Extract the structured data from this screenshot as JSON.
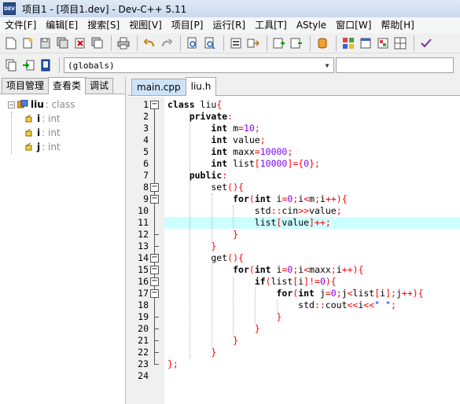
{
  "window": {
    "title": "项目1 - [项目1.dev] - Dev-C++ 5.11",
    "app_icon_text": "DEV"
  },
  "menu": [
    "文件[F]",
    "编辑[E]",
    "搜索[S]",
    "视图[V]",
    "项目[P]",
    "运行[R]",
    "工具[T]",
    "AStyle",
    "窗口[W]",
    "帮助[H]"
  ],
  "toolbar": {
    "globals_combo": "(globals)"
  },
  "left_panel": {
    "tabs": [
      "项目管理",
      "查看类",
      "调试"
    ],
    "active_tab": 1,
    "tree": {
      "class_name": "liu",
      "class_kind": ": class",
      "members": [
        {
          "name": "i",
          "type": ": int"
        },
        {
          "name": "i",
          "type": ": int"
        },
        {
          "name": "j",
          "type": ": int"
        }
      ]
    }
  },
  "editor": {
    "tabs": [
      "main.cpp",
      "liu.h"
    ],
    "active_tab": 1,
    "highlight_line": 11,
    "lines": [
      {
        "n": "1",
        "tokens": [
          [
            "kw",
            "class"
          ],
          [
            "id",
            " liu"
          ],
          [
            "sym",
            "{"
          ]
        ]
      },
      {
        "n": "2",
        "tokens": [
          [
            "id",
            "    "
          ],
          [
            "kw",
            "private"
          ],
          [
            "sym",
            ":"
          ]
        ]
      },
      {
        "n": "3",
        "tokens": [
          [
            "id",
            "        "
          ],
          [
            "kw",
            "int"
          ],
          [
            "id",
            " m"
          ],
          [
            "sym",
            "="
          ],
          [
            "num",
            "10"
          ],
          [
            "sym",
            ";"
          ]
        ]
      },
      {
        "n": "4",
        "tokens": [
          [
            "id",
            "        "
          ],
          [
            "kw",
            "int"
          ],
          [
            "id",
            " value"
          ],
          [
            "sym",
            ";"
          ]
        ]
      },
      {
        "n": "5",
        "tokens": [
          [
            "id",
            "        "
          ],
          [
            "kw",
            "int"
          ],
          [
            "id",
            " maxx"
          ],
          [
            "sym",
            "="
          ],
          [
            "num",
            "10000"
          ],
          [
            "sym",
            ";"
          ]
        ]
      },
      {
        "n": "6",
        "tokens": [
          [
            "id",
            "        "
          ],
          [
            "kw",
            "int"
          ],
          [
            "id",
            " list"
          ],
          [
            "sym",
            "["
          ],
          [
            "num",
            "10000"
          ],
          [
            "sym",
            "]={"
          ],
          [
            "num",
            "0"
          ],
          [
            "sym",
            "};"
          ]
        ]
      },
      {
        "n": "7",
        "tokens": [
          [
            "id",
            "    "
          ],
          [
            "kw",
            "public"
          ],
          [
            "sym",
            ":"
          ]
        ]
      },
      {
        "n": "8",
        "tokens": [
          [
            "id",
            "        set"
          ],
          [
            "sym",
            "(){"
          ]
        ]
      },
      {
        "n": "9",
        "tokens": [
          [
            "id",
            "            "
          ],
          [
            "kw",
            "for"
          ],
          [
            "sym",
            "("
          ],
          [
            "kw",
            "int"
          ],
          [
            "id",
            " i"
          ],
          [
            "sym",
            "="
          ],
          [
            "num",
            "0"
          ],
          [
            "sym",
            ";"
          ],
          [
            "id",
            "i"
          ],
          [
            "sym",
            "<"
          ],
          [
            "id",
            "m"
          ],
          [
            "sym",
            ";"
          ],
          [
            "id",
            "i"
          ],
          [
            "sym",
            "++){"
          ]
        ]
      },
      {
        "n": "10",
        "tokens": [
          [
            "id",
            "                std"
          ],
          [
            "sym",
            "::"
          ],
          [
            "id",
            "cin"
          ],
          [
            "sym",
            ">>"
          ],
          [
            "id",
            "value"
          ],
          [
            "sym",
            ";"
          ]
        ]
      },
      {
        "n": "11",
        "tokens": [
          [
            "id",
            "                list"
          ],
          [
            "sym",
            "["
          ],
          [
            "id",
            "value"
          ],
          [
            "sym",
            "]++;"
          ]
        ]
      },
      {
        "n": "12",
        "tokens": [
          [
            "id",
            "            "
          ],
          [
            "sym",
            "}"
          ]
        ]
      },
      {
        "n": "13",
        "tokens": [
          [
            "id",
            "        "
          ],
          [
            "sym",
            "}"
          ]
        ]
      },
      {
        "n": "14",
        "tokens": [
          [
            "id",
            "        get"
          ],
          [
            "sym",
            "(){"
          ]
        ]
      },
      {
        "n": "15",
        "tokens": [
          [
            "id",
            "            "
          ],
          [
            "kw",
            "for"
          ],
          [
            "sym",
            "("
          ],
          [
            "kw",
            "int"
          ],
          [
            "id",
            " i"
          ],
          [
            "sym",
            "="
          ],
          [
            "num",
            "0"
          ],
          [
            "sym",
            ";"
          ],
          [
            "id",
            "i"
          ],
          [
            "sym",
            "<"
          ],
          [
            "id",
            "maxx"
          ],
          [
            "sym",
            ";"
          ],
          [
            "id",
            "i"
          ],
          [
            "sym",
            "++){"
          ]
        ]
      },
      {
        "n": "16",
        "tokens": [
          [
            "id",
            "                "
          ],
          [
            "kw",
            "if"
          ],
          [
            "sym",
            "("
          ],
          [
            "id",
            "list"
          ],
          [
            "sym",
            "["
          ],
          [
            "id",
            "i"
          ],
          [
            "sym",
            "]!="
          ],
          [
            "num",
            "0"
          ],
          [
            "sym",
            "){"
          ]
        ]
      },
      {
        "n": "17",
        "tokens": [
          [
            "id",
            "                    "
          ],
          [
            "kw",
            "for"
          ],
          [
            "sym",
            "("
          ],
          [
            "kw",
            "int"
          ],
          [
            "id",
            " j"
          ],
          [
            "sym",
            "="
          ],
          [
            "num",
            "0"
          ],
          [
            "sym",
            ";"
          ],
          [
            "id",
            "j"
          ],
          [
            "sym",
            "<"
          ],
          [
            "id",
            "list"
          ],
          [
            "sym",
            "["
          ],
          [
            "id",
            "i"
          ],
          [
            "sym",
            "];"
          ],
          [
            "id",
            "j"
          ],
          [
            "sym",
            "++){"
          ]
        ]
      },
      {
        "n": "18",
        "tokens": [
          [
            "id",
            "                        std"
          ],
          [
            "sym",
            "::"
          ],
          [
            "id",
            "cout"
          ],
          [
            "sym",
            "<<"
          ],
          [
            "id",
            "i"
          ],
          [
            "sym",
            "<<"
          ],
          [
            "str",
            "\" \""
          ],
          [
            "sym",
            ";"
          ]
        ]
      },
      {
        "n": "19",
        "tokens": [
          [
            "id",
            "                    "
          ],
          [
            "sym",
            "}"
          ]
        ]
      },
      {
        "n": "20",
        "tokens": [
          [
            "id",
            "                "
          ],
          [
            "sym",
            "}"
          ]
        ]
      },
      {
        "n": "21",
        "tokens": [
          [
            "id",
            "            "
          ],
          [
            "sym",
            "}"
          ]
        ]
      },
      {
        "n": "22",
        "tokens": [
          [
            "id",
            "        "
          ],
          [
            "sym",
            "}"
          ]
        ]
      },
      {
        "n": "23",
        "tokens": [
          [
            "sym",
            "};"
          ]
        ]
      },
      {
        "n": "24",
        "tokens": []
      }
    ]
  },
  "colors": {
    "keyword": "#000000",
    "symbol": "#ff0000",
    "number": "#8000ff",
    "string": "#0000ff",
    "highlight": "#ccffff"
  }
}
